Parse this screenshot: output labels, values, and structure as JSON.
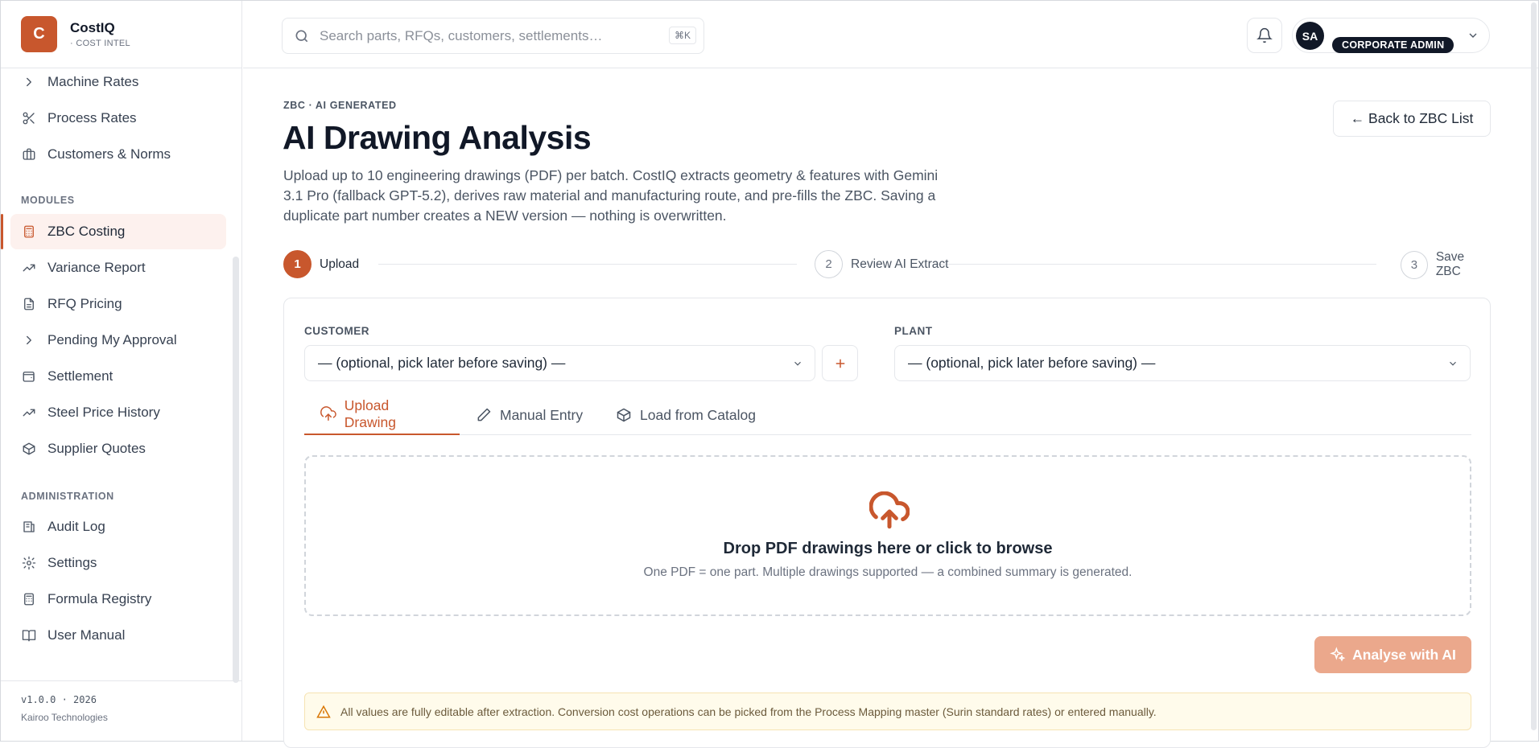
{
  "brand": {
    "logo_letter": "C",
    "name": "CostIQ",
    "subtitle": "· COST INTEL"
  },
  "sidebar": {
    "items_top": [
      {
        "label": "Machine Rates",
        "icon": "chevron-right-icon"
      },
      {
        "label": "Process Rates",
        "icon": "scissors-icon"
      },
      {
        "label": "Customers & Norms",
        "icon": "briefcase-icon"
      }
    ],
    "modules_label": "MODULES",
    "modules": [
      {
        "label": "ZBC Costing",
        "icon": "calculator-icon",
        "active": true
      },
      {
        "label": "Variance Report",
        "icon": "trending-up-icon"
      },
      {
        "label": "RFQ Pricing",
        "icon": "document-icon"
      },
      {
        "label": "Pending My Approval",
        "icon": "chevron-right-icon"
      },
      {
        "label": "Settlement",
        "icon": "wallet-icon"
      },
      {
        "label": "Steel Price History",
        "icon": "trending-up-icon"
      },
      {
        "label": "Supplier Quotes",
        "icon": "package-icon"
      }
    ],
    "admin_label": "ADMINISTRATION",
    "admin": [
      {
        "label": "Audit Log",
        "icon": "audit-log-icon"
      },
      {
        "label": "Settings",
        "icon": "gear-icon"
      },
      {
        "label": "Formula Registry",
        "icon": "calculator-icon"
      },
      {
        "label": "User Manual",
        "icon": "book-icon"
      }
    ],
    "version": "v1.0.0 · 2026",
    "company": "Kairoo Technologies"
  },
  "topbar": {
    "search_placeholder": "Search parts, RFQs, customers, settlements…",
    "shortcut": "⌘K",
    "user_initials": "SA",
    "user_role": "CORPORATE ADMIN"
  },
  "page": {
    "eyebrow": "ZBC · AI GENERATED",
    "title": "AI Drawing Analysis",
    "description": "Upload up to 10 engineering drawings (PDF) per batch. CostIQ extracts geometry & features with Gemini 3.1 Pro (fallback GPT-5.2), derives raw material and manufacturing route, and pre-fills the ZBC. Saving a duplicate part number creates a NEW version — nothing is overwritten.",
    "back_button": "← Back to ZBC List"
  },
  "steps": [
    {
      "number": "1",
      "label": "Upload",
      "active": true
    },
    {
      "number": "2",
      "label": "Review AI Extract",
      "active": false
    },
    {
      "number": "3",
      "label": "Save ZBC",
      "active": false
    }
  ],
  "form": {
    "customer_label": "CUSTOMER",
    "customer_value": "— (optional, pick later before saving) —",
    "plant_label": "PLANT",
    "plant_value": "— (optional, pick later before saving) —"
  },
  "tabs": [
    {
      "label": "Upload Drawing",
      "icon": "upload-cloud-icon",
      "active": true
    },
    {
      "label": "Manual Entry",
      "icon": "pencil-icon",
      "active": false
    },
    {
      "label": "Load from Catalog",
      "icon": "box-icon",
      "active": false
    }
  ],
  "dropzone": {
    "title": "Drop PDF drawings here or click to browse",
    "subtitle": "One PDF = one part. Multiple drawings supported — a combined summary is generated."
  },
  "analyse_button": "Analyse with AI",
  "notice": "All values are fully editable after extraction. Conversion cost operations can be picked from the Process Mapping master (Surin standard rates) or entered manually.",
  "colors": {
    "accent": "#c8572d",
    "accent_soft": "#fdf1ee",
    "disabled_button": "#eba88c",
    "notice_bg": "#fffbeb"
  }
}
